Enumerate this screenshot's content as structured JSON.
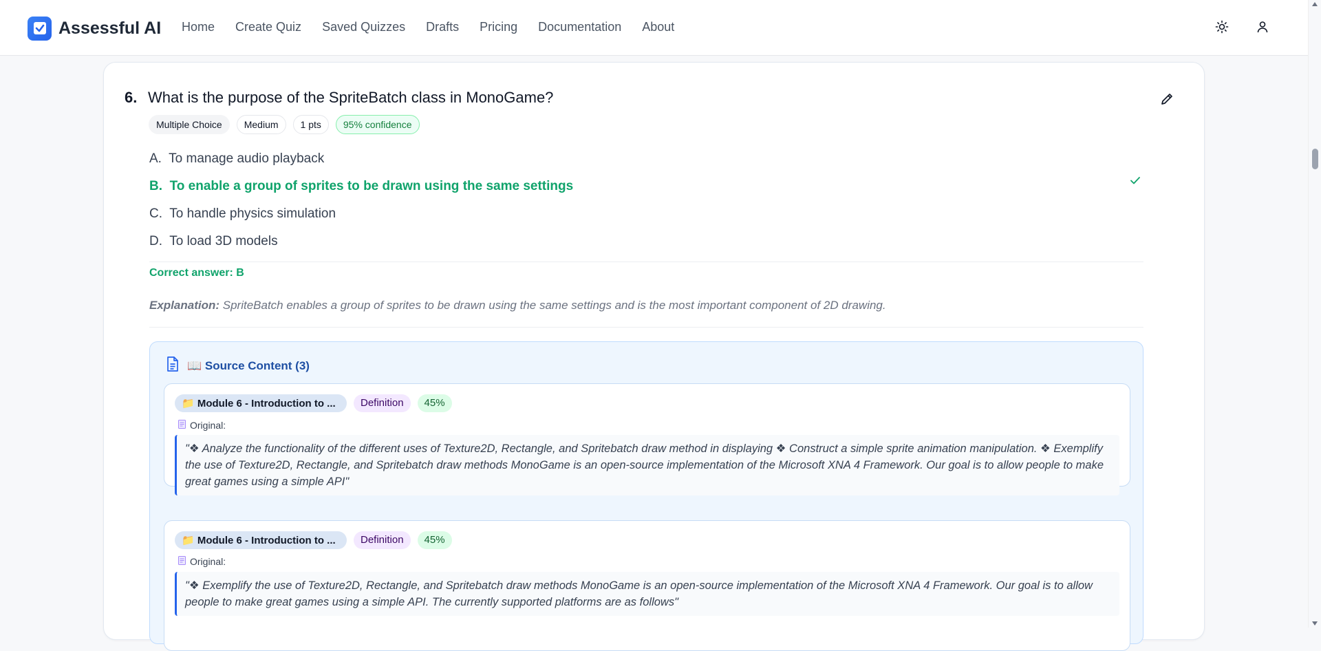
{
  "brand": {
    "name": "Assessful AI"
  },
  "nav": {
    "items": [
      "Home",
      "Create Quiz",
      "Saved Quizzes",
      "Drafts",
      "Pricing",
      "Documentation",
      "About"
    ]
  },
  "question": {
    "number": "6.",
    "text": "What is the purpose of the SpriteBatch class in MonoGame?",
    "badges": [
      "Multiple Choice",
      "Medium",
      "1 pts",
      "95% confidence"
    ],
    "options": [
      {
        "letter": "A.",
        "text": "To manage audio playback"
      },
      {
        "letter": "B.",
        "text": "To enable a group of sprites to be drawn using the same settings"
      },
      {
        "letter": "C.",
        "text": "To handle physics simulation"
      },
      {
        "letter": "D.",
        "text": "To load 3D models"
      }
    ],
    "correct_answer": "Correct answer: B",
    "explanation_label": "Explanation:",
    "explanation_text": " SpriteBatch enables a group of sprites to be drawn using the same settings and is the most important component of 2D drawing."
  },
  "source": {
    "title": "📖 Source Content (3)",
    "items": [
      {
        "module": "📁 Module 6 - Introduction to ...",
        "type": "Definition",
        "percent": "45%",
        "original_label": "Original:",
        "quote": "\"❖ Analyze the functionality of the different uses of Texture2D, Rectangle, and Spritebatch draw method in displaying ❖ Construct a simple sprite animation manipulation. ❖ Exemplify the use of Texture2D, Rectangle, and Spritebatch draw methods MonoGame is an open-source implementation of the Microsoft XNA 4 Framework. Our goal is to allow people to make great games using a simple API\""
      },
      {
        "module": "📁 Module 6 - Introduction to ...",
        "type": "Definition",
        "percent": "45%",
        "original_label": "Original:",
        "quote": "\"❖ Exemplify the use of Texture2D, Rectangle, and Spritebatch draw methods MonoGame is an open-source implementation of the Microsoft XNA 4 Framework. Our goal is to allow people to make great games using a simple API. The currently supported platforms are as follows\""
      }
    ]
  },
  "colors": {
    "accent": "#2563eb",
    "correct": "#10a36b",
    "source_bg": "#eef6fe"
  }
}
